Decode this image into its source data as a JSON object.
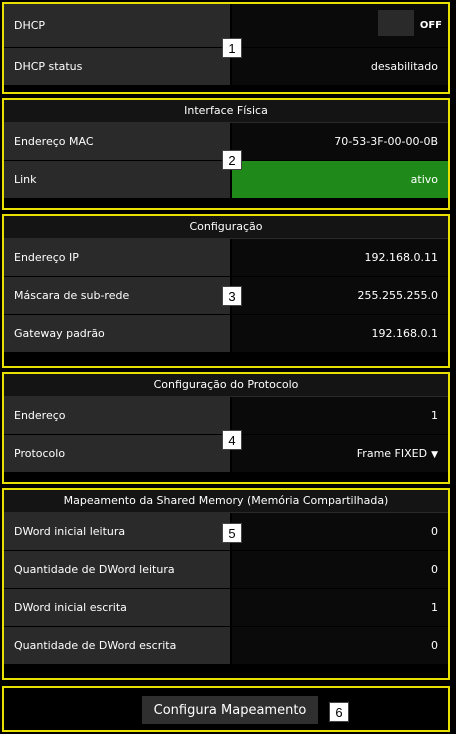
{
  "dhcp": {
    "label": "DHCP",
    "toggle_state": "OFF",
    "status_label": "DHCP status",
    "status_value": "desabilitado"
  },
  "physical": {
    "title": "Interface Física",
    "mac_label": "Endereço MAC",
    "mac_value": "70-53-3F-00-00-0B",
    "link_label": "Link",
    "link_value": "ativo",
    "link_color": "#1f8a1a"
  },
  "config": {
    "title": "Configuração",
    "ip_label": "Endereço IP",
    "ip_value": "192.168.0.11",
    "mask_label": "Máscara de sub-rede",
    "mask_value": "255.255.255.0",
    "gateway_label": "Gateway padrão",
    "gateway_value": "192.168.0.1"
  },
  "protocol": {
    "title": "Configuração do Protocolo",
    "address_label": "Endereço",
    "address_value": "1",
    "protocol_label": "Protocolo",
    "protocol_value": "Frame FIXED"
  },
  "shared": {
    "title": "Mapeamento da Shared Memory (Memória Compartilhada)",
    "read_start_label": "DWord inicial leitura",
    "read_start_value": "0",
    "read_qty_label": "Quantidade de DWord leitura",
    "read_qty_value": "0",
    "write_start_label": "DWord inicial escrita",
    "write_start_value": "1",
    "write_qty_label": "Quantidade de DWord escrita",
    "write_qty_value": "0"
  },
  "action": {
    "button_label": "Configura Mapeamento"
  },
  "markers": [
    "1",
    "2",
    "3",
    "4",
    "5",
    "6"
  ],
  "colors": {
    "highlight_border": "#e8e000",
    "active_green": "#1f8a1a"
  }
}
